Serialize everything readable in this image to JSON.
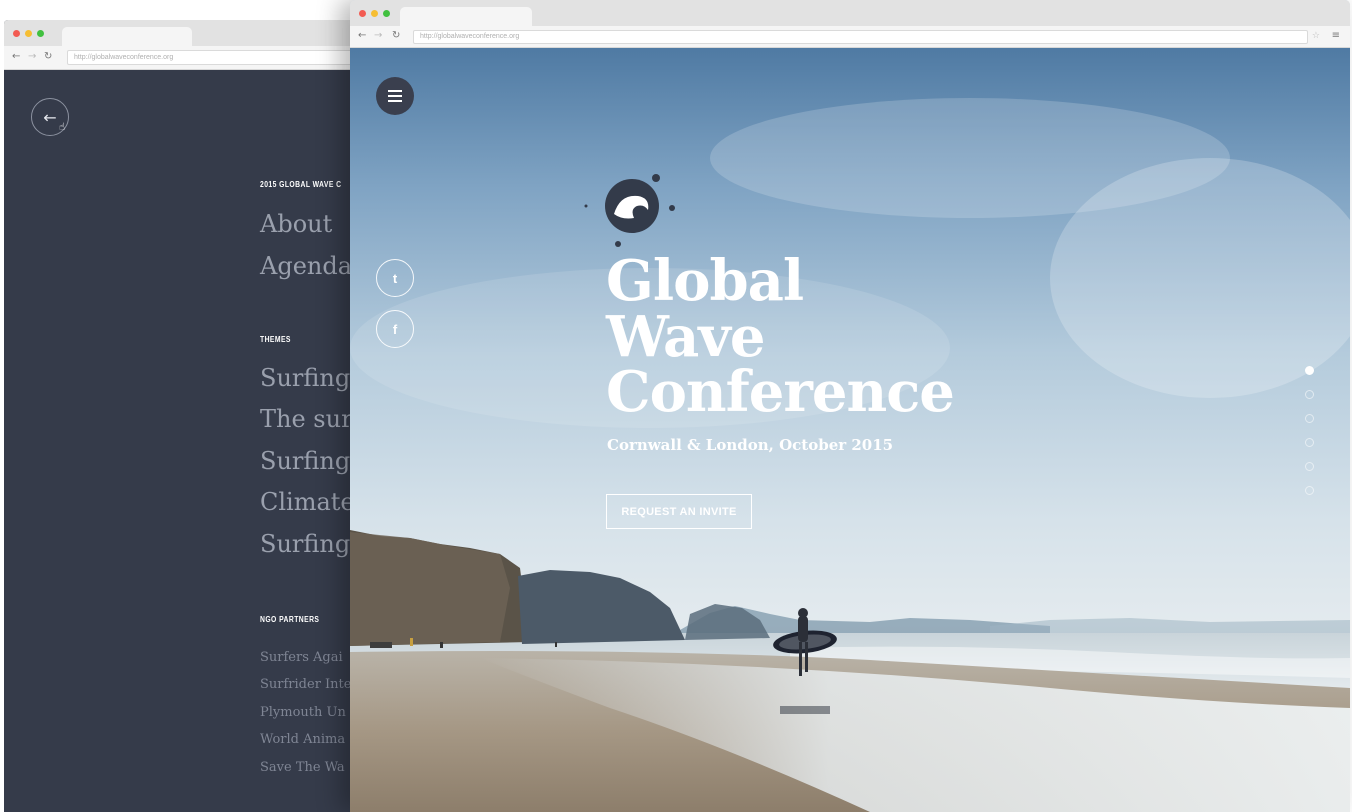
{
  "colors": {
    "menu_bg": "#353b4a",
    "chrome_bg": "#e2e2e2",
    "close_dot": "#f25b52",
    "minimize_dot": "#f6be33",
    "zoom_dot": "#41c03f"
  },
  "icons": {
    "back": "arrow-left-icon",
    "menu": "hamburger-icon",
    "twitter": "twitter-icon",
    "facebook": "facebook-icon",
    "logo": "wave-logo-icon",
    "reload": "reload-icon",
    "bookmark": "star-icon"
  },
  "back_window": {
    "url": "http://globalwaveconference.org",
    "menu": {
      "conference_label": "2015 GLOBAL WAVE C",
      "primary_links": [
        "About",
        "Agenda"
      ],
      "themes_label": "THEMES",
      "theme_links": [
        "Surfing",
        "The sur",
        "Surfing",
        "Climate",
        "Surfing"
      ],
      "partners_label": "NGO PARTNERS",
      "partner_links": [
        "Surfers Agai",
        "Surfrider Inte",
        "Plymouth Un",
        "World Anima",
        "Save The Wa"
      ]
    }
  },
  "front_window": {
    "url": "http://globalwaveconference.org",
    "hero": {
      "title_lines": [
        "Global",
        "Wave",
        "Conference"
      ],
      "subtitle": "Cornwall & London, October 2015",
      "cta_label": "REQUEST AN INVITE",
      "social": {
        "twitter_glyph": "t",
        "facebook_glyph": "f"
      },
      "pager": {
        "slides": 6,
        "active_index": 0
      }
    }
  }
}
